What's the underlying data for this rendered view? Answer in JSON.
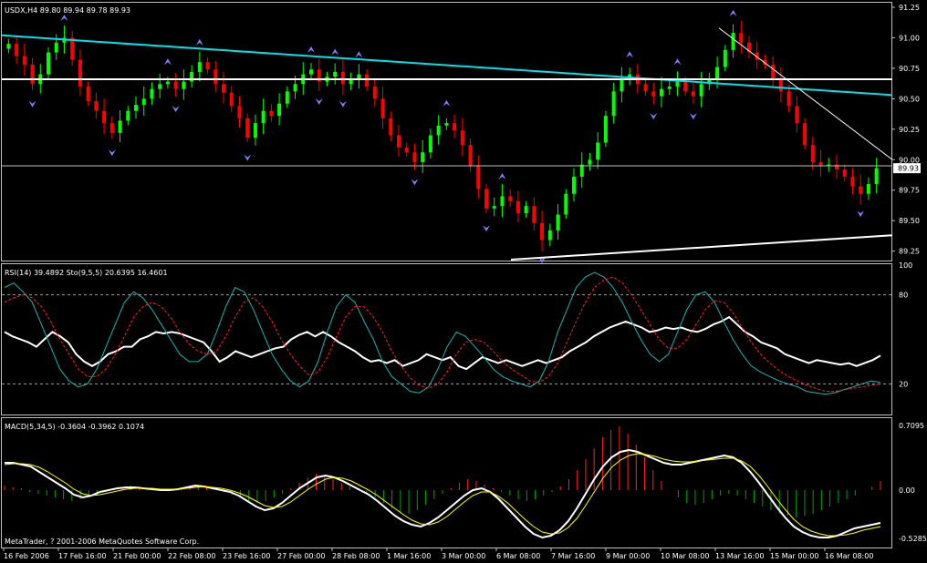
{
  "window": {
    "copyright": "MetaTrader, ? 2001-2006 MetaQuotes Software Corp."
  },
  "price_panel": {
    "header": "USDX,H4  89.80 89.94 89.78 89.93",
    "last_price_label": "89.93",
    "colors": {
      "bull": "#00ff00",
      "bear": "#ff0000",
      "trendline_main": "#00e0e8",
      "hline": "#ffffff",
      "fractal": "#8080ff"
    }
  },
  "rsi_panel": {
    "header": "RSI(14) 39.4892  Sto(9,5,5) 20.6395 16.4601",
    "levels": [
      80,
      20
    ],
    "colors": {
      "rsi": "#ffffff",
      "sto_main": "#20b0b0",
      "sto_signal": "#ff2020"
    }
  },
  "macd_panel": {
    "header": "MACD(5,34,5) -0.3604 -0.3962 0.1074",
    "colors": {
      "hist_up": "#ff2020",
      "hist_down": "#00a000",
      "macd": "#ffffff",
      "signal": "#ffff00"
    }
  },
  "x_axis": {
    "labels": [
      "16 Feb 2006",
      "17 Feb 16:00",
      "21 Feb 00:00",
      "22 Feb 08:00",
      "23 Feb 16:00",
      "27 Feb 00:00",
      "28 Feb 08:00",
      "1 Mar 16:00",
      "3 Mar 00:00",
      "6 Mar 08:00",
      "7 Mar 16:00",
      "9 Mar 00:00",
      "10 Mar 08:00",
      "13 Mar 16:00",
      "15 Mar 00:00",
      "16 Mar 08:00"
    ]
  },
  "chart_data": [
    {
      "type": "candlestick",
      "title": "USDX,H4",
      "ohlc_last": [
        89.8,
        89.94,
        89.78,
        89.93
      ],
      "ylim": [
        89.18,
        91.28
      ],
      "y_ticks": [
        91.25,
        91.0,
        90.75,
        90.5,
        90.25,
        90.0,
        89.75,
        89.5,
        89.25
      ],
      "closes": [
        90.95,
        90.85,
        90.78,
        90.62,
        90.7,
        90.88,
        90.96,
        91.0,
        90.82,
        90.6,
        90.48,
        90.4,
        90.3,
        90.22,
        90.32,
        90.4,
        90.45,
        90.5,
        90.58,
        90.62,
        90.64,
        90.58,
        90.64,
        90.72,
        90.8,
        90.74,
        90.62,
        90.55,
        90.44,
        90.34,
        90.18,
        90.3,
        90.4,
        90.36,
        90.46,
        90.56,
        90.62,
        90.7,
        90.74,
        90.64,
        90.68,
        90.72,
        90.62,
        90.66,
        90.7,
        90.6,
        90.5,
        90.34,
        90.2,
        90.1,
        90.06,
        89.98,
        90.06,
        90.2,
        90.28,
        90.3,
        90.24,
        90.12,
        89.95,
        89.76,
        89.6,
        89.62,
        89.7,
        89.66,
        89.56,
        89.62,
        89.48,
        89.34,
        89.42,
        89.55,
        89.72,
        89.86,
        89.96,
        90.0,
        90.14,
        90.36,
        90.56,
        90.66,
        90.7,
        90.62,
        90.56,
        90.52,
        90.58,
        90.6,
        90.64,
        90.56,
        90.52,
        90.62,
        90.66,
        90.76,
        90.9,
        91.04,
        90.96,
        90.88,
        90.82,
        90.78,
        90.66,
        90.56,
        90.44,
        90.3,
        90.12,
        89.98,
        89.95,
        89.96,
        89.92,
        89.86,
        89.78,
        89.72,
        89.8,
        89.93
      ],
      "trendlines": [
        {
          "name": "",
          "from_price": 91.02,
          "to_price": 90.53
        },
        {
          "name": "",
          "from_price": 90.66,
          "to_price": 90.66
        },
        {
          "name": "",
          "from_price": 89.95,
          "to_price": 89.95
        },
        {
          "name": "",
          "from_price": 89.18,
          "to_price": 89.38
        },
        {
          "name": "",
          "from_price": 91.08,
          "to_price": 90.0
        }
      ]
    },
    {
      "type": "line",
      "title": "RSI(14) / Stochastic(9,5,5)",
      "ylim": [
        0,
        100
      ],
      "y_ticks": [
        100,
        80,
        20,
        0
      ],
      "series": [
        {
          "name": "RSI(14)",
          "values": [
            55,
            52,
            50,
            48,
            45,
            50,
            55,
            52,
            48,
            40,
            35,
            32,
            35,
            40,
            42,
            45,
            45,
            50,
            52,
            55,
            54,
            55,
            54,
            52,
            50,
            48,
            42,
            35,
            38,
            42,
            40,
            38,
            40,
            42,
            44,
            45,
            50,
            53,
            55,
            52,
            55,
            52,
            48,
            45,
            42,
            38,
            35,
            36,
            34,
            36,
            32,
            34,
            36,
            40,
            38,
            36,
            38,
            32,
            30,
            34,
            38,
            36,
            34,
            36,
            34,
            32,
            34,
            36,
            34,
            36,
            38,
            42,
            45,
            48,
            52,
            55,
            58,
            60,
            62,
            60,
            58,
            55,
            56,
            58,
            57,
            58,
            56,
            55,
            57,
            60,
            62,
            65,
            60,
            55,
            52,
            48,
            46,
            44,
            40,
            38,
            36,
            34,
            36,
            35,
            34,
            33,
            34,
            32,
            34,
            36,
            39
          ]
        },
        {
          "name": "Sto(9,5,5) main",
          "values": [
            85,
            88,
            82,
            75,
            60,
            45,
            30,
            22,
            18,
            20,
            30,
            45,
            60,
            75,
            82,
            78,
            70,
            60,
            50,
            40,
            35,
            35,
            40,
            55,
            72,
            85,
            82,
            70,
            55,
            40,
            30,
            22,
            18,
            22,
            35,
            55,
            72,
            80,
            75,
            62,
            50,
            35,
            25,
            20,
            15,
            14,
            18,
            30,
            45,
            55,
            52,
            45,
            38,
            30,
            25,
            22,
            20,
            18,
            22,
            35,
            55,
            70,
            85,
            92,
            95,
            92,
            85,
            75,
            62,
            50,
            40,
            35,
            40,
            55,
            70,
            80,
            82,
            75,
            62,
            50,
            40,
            32,
            28,
            25,
            22,
            20,
            18,
            15,
            14,
            13,
            14,
            16,
            18,
            20,
            22,
            21
          ]
        },
        {
          "name": "Sto(9,5,5) signal",
          "values": [
            75,
            78,
            80,
            78,
            72,
            62,
            50,
            40,
            30,
            25,
            25,
            30,
            40,
            52,
            65,
            72,
            75,
            72,
            65,
            55,
            47,
            42,
            40,
            42,
            52,
            65,
            75,
            78,
            72,
            62,
            50,
            40,
            32,
            26,
            28,
            38,
            52,
            65,
            72,
            72,
            65,
            55,
            42,
            32,
            24,
            19,
            17,
            20,
            28,
            40,
            48,
            50,
            48,
            42,
            35,
            30,
            26,
            22,
            21,
            25,
            34,
            48,
            62,
            75,
            85,
            90,
            92,
            88,
            80,
            70,
            60,
            50,
            44,
            44,
            50,
            60,
            70,
            76,
            75,
            68,
            58,
            48,
            40,
            34,
            29,
            25,
            22,
            19,
            17,
            15,
            15,
            16,
            17,
            18,
            19,
            20
          ]
        }
      ]
    },
    {
      "type": "bar",
      "title": "MACD(5,34,5)",
      "ylim": [
        -0.62,
        0.76
      ],
      "y_ticks": [
        0.7095,
        0.0,
        -0.5285
      ],
      "histogram": [
        0.05,
        0.03,
        0.02,
        -0.02,
        -0.04,
        -0.06,
        -0.08,
        -0.1,
        -0.12,
        -0.1,
        -0.08,
        -0.05,
        -0.02,
        0.01,
        0.03,
        0.05,
        0.04,
        0.03,
        0.02,
        0.01,
        0.02,
        0.03,
        0.05,
        0.04,
        0.02,
        0.0,
        -0.02,
        -0.05,
        -0.08,
        -0.12,
        -0.14,
        -0.12,
        -0.08,
        -0.04,
        0.02,
        0.08,
        0.14,
        0.18,
        0.16,
        0.12,
        0.08,
        0.04,
        0.01,
        -0.03,
        -0.08,
        -0.14,
        -0.2,
        -0.24,
        -0.26,
        -0.22,
        -0.16,
        -0.1,
        -0.04,
        0.02,
        0.08,
        0.12,
        0.1,
        0.06,
        0.02,
        -0.02,
        -0.06,
        -0.1,
        -0.12,
        -0.1,
        -0.06,
        -0.02,
        0.04,
        0.12,
        0.22,
        0.34,
        0.46,
        0.58,
        0.66,
        0.7,
        0.62,
        0.5,
        0.36,
        0.22,
        0.1,
        0.0,
        -0.08,
        -0.14,
        -0.16,
        -0.14,
        -0.1,
        -0.06,
        -0.04,
        -0.06,
        -0.1,
        -0.14,
        -0.18,
        -0.22,
        -0.26,
        -0.28,
        -0.3,
        -0.28,
        -0.26,
        -0.22,
        -0.18,
        -0.14,
        -0.1,
        -0.06,
        0.0,
        0.04,
        0.1
      ],
      "series": [
        {
          "name": "MACD",
          "values": [
            0.3,
            0.3,
            0.28,
            0.26,
            0.2,
            0.14,
            0.08,
            0.02,
            -0.05,
            -0.08,
            -0.06,
            -0.02,
            0.0,
            0.02,
            0.03,
            0.03,
            0.02,
            0.01,
            0.0,
            0.0,
            0.01,
            0.03,
            0.05,
            0.04,
            0.02,
            0.0,
            -0.02,
            -0.06,
            -0.12,
            -0.18,
            -0.22,
            -0.2,
            -0.14,
            -0.06,
            0.02,
            0.08,
            0.14,
            0.16,
            0.14,
            0.1,
            0.05,
            0.0,
            -0.05,
            -0.12,
            -0.2,
            -0.28,
            -0.34,
            -0.38,
            -0.4,
            -0.36,
            -0.3,
            -0.22,
            -0.14,
            -0.06,
            0.0,
            0.02,
            -0.02,
            -0.1,
            -0.2,
            -0.3,
            -0.4,
            -0.48,
            -0.52,
            -0.5,
            -0.44,
            -0.34,
            -0.2,
            -0.04,
            0.12,
            0.26,
            0.36,
            0.42,
            0.44,
            0.42,
            0.38,
            0.34,
            0.3,
            0.28,
            0.28,
            0.3,
            0.32,
            0.34,
            0.36,
            0.38,
            0.36,
            0.3,
            0.2,
            0.08,
            -0.05,
            -0.18,
            -0.3,
            -0.4,
            -0.46,
            -0.5,
            -0.52,
            -0.52,
            -0.5,
            -0.46,
            -0.42,
            -0.4,
            -0.38,
            -0.36
          ]
        },
        {
          "name": "Signal",
          "values": [
            0.28,
            0.29,
            0.29,
            0.28,
            0.25,
            0.2,
            0.14,
            0.08,
            0.01,
            -0.04,
            -0.06,
            -0.05,
            -0.03,
            -0.01,
            0.01,
            0.02,
            0.02,
            0.02,
            0.01,
            0.01,
            0.01,
            0.02,
            0.03,
            0.04,
            0.03,
            0.02,
            0.0,
            -0.03,
            -0.07,
            -0.12,
            -0.17,
            -0.19,
            -0.18,
            -0.13,
            -0.06,
            0.01,
            0.07,
            0.12,
            0.14,
            0.13,
            0.1,
            0.05,
            0.0,
            -0.06,
            -0.13,
            -0.2,
            -0.27,
            -0.33,
            -0.37,
            -0.38,
            -0.35,
            -0.29,
            -0.21,
            -0.13,
            -0.06,
            -0.02,
            -0.02,
            -0.07,
            -0.14,
            -0.23,
            -0.32,
            -0.4,
            -0.46,
            -0.48,
            -0.47,
            -0.41,
            -0.31,
            -0.17,
            -0.02,
            0.13,
            0.25,
            0.33,
            0.38,
            0.4,
            0.39,
            0.37,
            0.34,
            0.32,
            0.31,
            0.31,
            0.32,
            0.33,
            0.34,
            0.35,
            0.35,
            0.32,
            0.26,
            0.16,
            0.04,
            -0.09,
            -0.21,
            -0.32,
            -0.4,
            -0.45,
            -0.48,
            -0.5,
            -0.5,
            -0.49,
            -0.47,
            -0.44,
            -0.42,
            -0.4
          ]
        }
      ]
    }
  ]
}
